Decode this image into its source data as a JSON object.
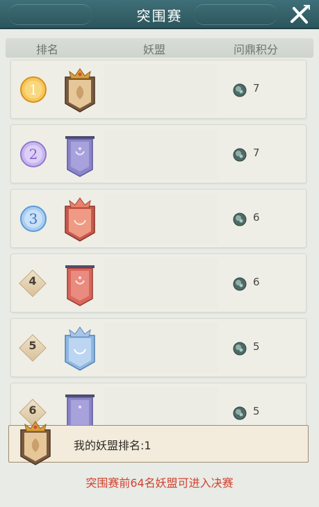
{
  "header": {
    "title": "突围赛"
  },
  "columns": {
    "rank": "排名",
    "union": "妖盟",
    "score": "问鼎积分"
  },
  "rows": [
    {
      "rank": "1",
      "score": "7",
      "medal": "gold",
      "banner": "gold-crown-banner"
    },
    {
      "rank": "2",
      "score": "7",
      "medal": "purple",
      "banner": "purple-banner"
    },
    {
      "rank": "3",
      "score": "6",
      "medal": "blue",
      "banner": "red-crown-banner"
    },
    {
      "rank": "4",
      "score": "6",
      "medal": "none",
      "banner": "red-banner"
    },
    {
      "rank": "5",
      "score": "5",
      "medal": "none",
      "banner": "blue-crown-banner"
    },
    {
      "rank": "6",
      "score": "5",
      "medal": "none",
      "banner": "purple-banner"
    }
  ],
  "my_rank": {
    "label": "我的妖盟排名:1"
  },
  "notice": "突围赛前64名妖盟可进入决赛",
  "colors": {
    "header": "#2c555d",
    "row_bg": "#eeeee6",
    "notice": "#d3412e",
    "gold": "#e9a82e",
    "purple": "#9a7ed6",
    "blue": "#5a9ad8",
    "red_banner": "#d8675c",
    "purple_banner": "#8b86c8",
    "blue_banner": "#8fb7e2"
  },
  "icons": {
    "close": "close-x-icon",
    "score": "jade-orb-icon"
  }
}
